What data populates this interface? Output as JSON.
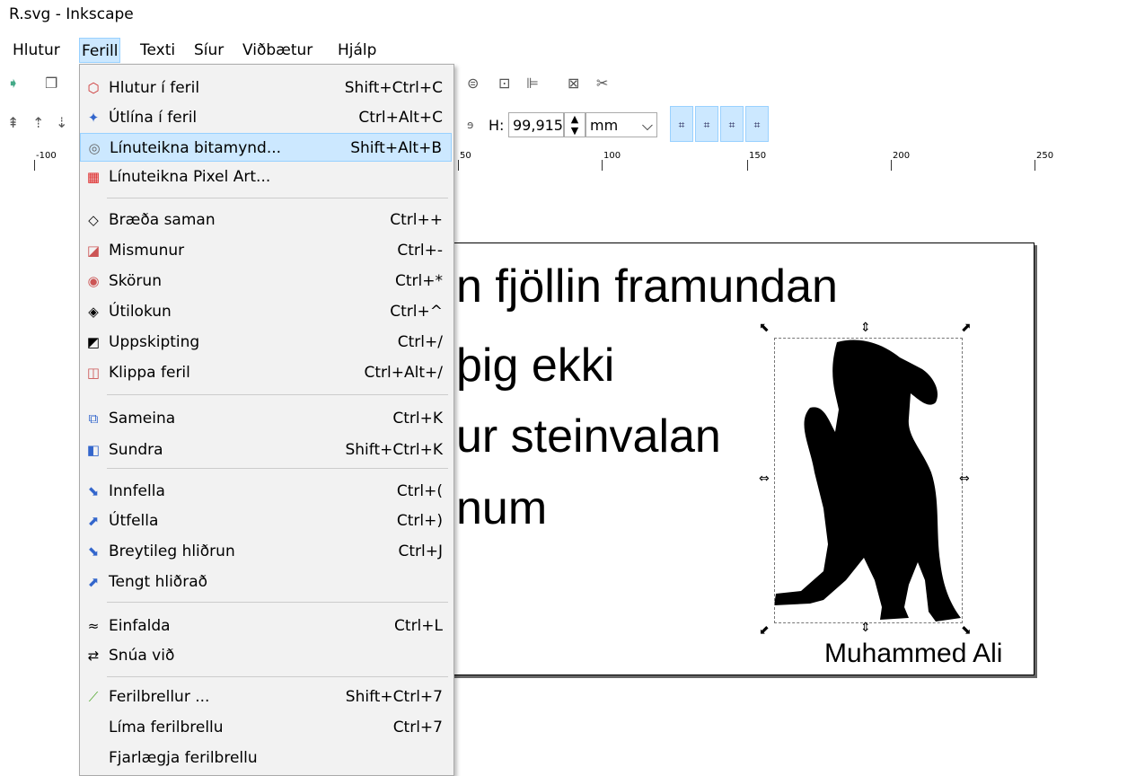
{
  "window": {
    "title": "R.svg - Inkscape"
  },
  "menubar": [
    {
      "label": "Hlutur",
      "active": false
    },
    {
      "label": "Ferill",
      "active": true
    },
    {
      "label": "Texti",
      "active": false
    },
    {
      "label": "Síur",
      "active": false
    },
    {
      "label": "Viðbætur",
      "active": false
    },
    {
      "label": "Hjálp",
      "active": false
    }
  ],
  "toolbar": {
    "h_label": "H:",
    "h_value": "99,915",
    "unit": "mm"
  },
  "ruler": {
    "ticks": [
      "-100",
      "50",
      "100",
      "150",
      "200",
      "250"
    ]
  },
  "menu": {
    "items": [
      {
        "label": "Hlutur í feril",
        "shortcut": "Shift+Ctrl+C",
        "icon": "object-to-path-icon",
        "highlighted": false
      },
      {
        "label": "Útlína í feril",
        "shortcut": "Ctrl+Alt+C",
        "icon": "stroke-to-path-icon",
        "highlighted": false
      },
      {
        "label": "Línuteikna bitamynd...",
        "shortcut": "Shift+Alt+B",
        "icon": "trace-bitmap-icon",
        "highlighted": true
      },
      {
        "label": "Línuteikna Pixel Art...",
        "shortcut": "",
        "icon": "trace-pixel-art-icon",
        "highlighted": false
      },
      {
        "label": "Bræða saman",
        "shortcut": "Ctrl++",
        "icon": "union-icon",
        "highlighted": false
      },
      {
        "label": "Mismunur",
        "shortcut": "Ctrl+-",
        "icon": "difference-icon",
        "highlighted": false
      },
      {
        "label": "Skörun",
        "shortcut": "Ctrl+*",
        "icon": "intersection-icon",
        "highlighted": false
      },
      {
        "label": "Útilokun",
        "shortcut": "Ctrl+^",
        "icon": "exclusion-icon",
        "highlighted": false
      },
      {
        "label": "Uppskipting",
        "shortcut": "Ctrl+/",
        "icon": "division-icon",
        "highlighted": false
      },
      {
        "label": "Klippa feril",
        "shortcut": "Ctrl+Alt+/",
        "icon": "cut-path-icon",
        "highlighted": false
      },
      {
        "label": "Sameina",
        "shortcut": "Ctrl+K",
        "icon": "combine-icon",
        "highlighted": false
      },
      {
        "label": "Sundra",
        "shortcut": "Shift+Ctrl+K",
        "icon": "break-apart-icon",
        "highlighted": false
      },
      {
        "label": "Innfella",
        "shortcut": "Ctrl+(",
        "icon": "inset-icon",
        "highlighted": false
      },
      {
        "label": "Útfella",
        "shortcut": "Ctrl+)",
        "icon": "outset-icon",
        "highlighted": false
      },
      {
        "label": "Breytileg hliðrun",
        "shortcut": "Ctrl+J",
        "icon": "dynamic-offset-icon",
        "highlighted": false
      },
      {
        "label": "Tengt hliðrað",
        "shortcut": "",
        "icon": "linked-offset-icon",
        "highlighted": false
      },
      {
        "label": "Einfalda",
        "shortcut": "Ctrl+L",
        "icon": "simplify-icon",
        "highlighted": false
      },
      {
        "label": "Snúa við",
        "shortcut": "",
        "icon": "reverse-icon",
        "highlighted": false
      },
      {
        "label": "Ferilbrellur ...",
        "shortcut": "Shift+Ctrl+7",
        "icon": "path-effects-icon",
        "highlighted": false
      },
      {
        "label": "Líma ferilbrellu",
        "shortcut": "Ctrl+7",
        "icon": "",
        "highlighted": false
      },
      {
        "label": "Fjarlægja ferilbrellu",
        "shortcut": "",
        "icon": "",
        "highlighted": false
      }
    ]
  },
  "canvas": {
    "lines": [
      "n fjöllin framundan",
      "þig ekki",
      "ur steinvalan",
      "num"
    ],
    "caption": "Muhammed Ali"
  }
}
